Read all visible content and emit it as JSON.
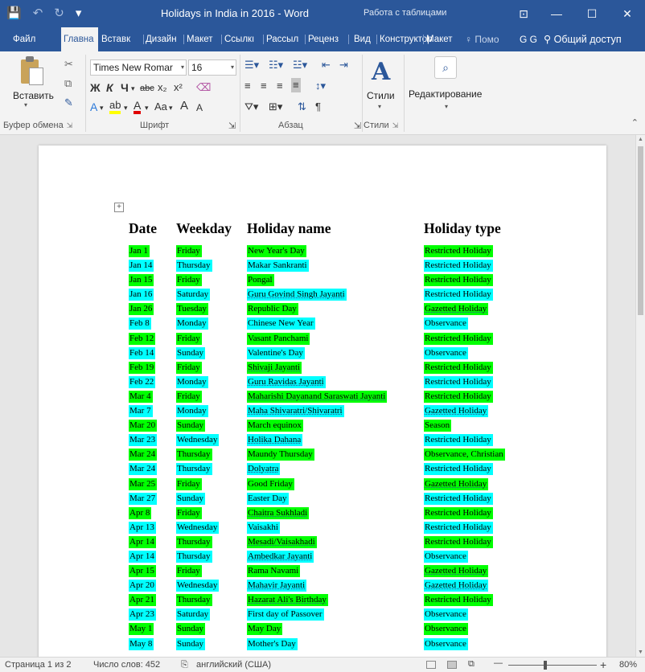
{
  "title_bar": {
    "doc_title": "Holidays in India in 2016 - Word",
    "context_title": "Работа с таблицами",
    "qat": {
      "save_icon": "💾",
      "undo_icon": "↶",
      "redo_icon": "↻",
      "customize_icon": "▾"
    },
    "buttons": {
      "ribbon_options": "⊡",
      "minimize": "—",
      "maximize": "☐",
      "close": "✕"
    }
  },
  "tabs": [
    {
      "label": "Файл"
    },
    {
      "label": "Главна"
    },
    {
      "label": "Вставк"
    },
    {
      "label": "Дизайн"
    },
    {
      "label": "Макет"
    },
    {
      "label": "Ссылкı"
    },
    {
      "label": "Рассыл"
    },
    {
      "label": "Реценз"
    },
    {
      "label": "Вид"
    },
    {
      "label": "Конструктор"
    },
    {
      "label": "Макет"
    }
  ],
  "tellme": "Помо",
  "user_initials": "G G",
  "share": "Общий доступ",
  "ribbon": {
    "paste_label": "Вставить",
    "font_name": "Times New Romar",
    "font_size": "16",
    "bold": "Ж",
    "italic": "К",
    "underline": "Ч",
    "strike": "abc",
    "subscript": "x₂",
    "superscript": "x²",
    "change_case": "Aa",
    "grow": "A",
    "shrink": "A",
    "styles_label": "Стили",
    "edit_label": "Редактирование",
    "groups": {
      "clipboard": "Буфер обмена",
      "font": "Шрифт",
      "paragraph": "Абзац",
      "styles": "Стили"
    }
  },
  "table": {
    "headers": {
      "date": "Date",
      "weekday": "Weekday",
      "name": "Holiday name",
      "type": "Holiday type"
    },
    "rows": [
      {
        "date": "Jan 1",
        "weekday": "Friday",
        "name": "New Year's Day",
        "type": "Restricted Holiday"
      },
      {
        "date": "Jan 14",
        "weekday": "Thursday",
        "name": "Makar Sankranti",
        "type": "Restricted Holiday"
      },
      {
        "date": "Jan 15",
        "weekday": "Friday",
        "name": "Pongal",
        "type": "Restricted Holiday"
      },
      {
        "date": "Jan 16",
        "weekday": "Saturday",
        "name": "Guru Govind Singh Jayanti",
        "type": "Restricted Holiday"
      },
      {
        "date": "Jan 26",
        "weekday": "Tuesday",
        "name": "Republic Day",
        "type": "Gazetted Holiday"
      },
      {
        "date": "Feb 8",
        "weekday": "Monday",
        "name": "Chinese New Year",
        "type": "Observance"
      },
      {
        "date": "Feb 12",
        "weekday": "Friday",
        "name": "Vasant Panchami",
        "type": "Restricted Holiday"
      },
      {
        "date": "Feb 14",
        "weekday": "Sunday",
        "name": "Valentine's Day",
        "type": "Observance"
      },
      {
        "date": "Feb 19",
        "weekday": "Friday",
        "name": "Shivaji Jayanti",
        "type": "Restricted Holiday"
      },
      {
        "date": "Feb 22",
        "weekday": "Monday",
        "name": "Guru Ravidas Jayanti",
        "type": "Restricted Holiday"
      },
      {
        "date": "Mar 4",
        "weekday": "Friday",
        "name": "Maharishi Dayanand Saraswati Jayanti",
        "type": "Restricted Holiday"
      },
      {
        "date": "Mar 7",
        "weekday": "Monday",
        "name": "Maha Shivaratri/Shivaratri",
        "type": "Gazetted Holiday"
      },
      {
        "date": "Mar 20",
        "weekday": "Sunday",
        "name": "March equinox",
        "type": "Season"
      },
      {
        "date": "Mar 23",
        "weekday": "Wednesday",
        "name": "Holika Dahana",
        "type": "Restricted Holiday"
      },
      {
        "date": "Mar 24",
        "weekday": "Thursday",
        "name": "Maundy Thursday",
        "type": "Observance, Christian"
      },
      {
        "date": "Mar 24",
        "weekday": "Thursday",
        "name": "Dolyatra",
        "type": "Restricted Holiday"
      },
      {
        "date": "Mar 25",
        "weekday": "Friday",
        "name": "Good Friday",
        "type": "Gazetted Holiday"
      },
      {
        "date": "Mar 27",
        "weekday": "Sunday",
        "name": "Easter Day",
        "type": "Restricted Holiday"
      },
      {
        "date": "Apr 8",
        "weekday": "Friday",
        "name": "Chaitra Sukhladi",
        "type": "Restricted Holiday"
      },
      {
        "date": "Apr 13",
        "weekday": "Wednesday",
        "name": "Vaisakhi",
        "type": "Restricted Holiday"
      },
      {
        "date": "Apr 14",
        "weekday": "Thursday",
        "name": "Mesadi/Vaisakhadi",
        "type": "Restricted Holiday"
      },
      {
        "date": "Apr 14",
        "weekday": "Thursday",
        "name": "Ambedkar Jayanti",
        "type": "Observance"
      },
      {
        "date": "Apr 15",
        "weekday": "Friday",
        "name": "Rama Navami",
        "type": "Gazetted Holiday"
      },
      {
        "date": "Apr 20",
        "weekday": "Wednesday",
        "name": "Mahavir Jayanti",
        "type": "Gazetted Holiday"
      },
      {
        "date": "Apr 21",
        "weekday": "Thursday",
        "name": "Hazarat Ali's Birthday",
        "type": "Restricted Holiday"
      },
      {
        "date": "Apr 23",
        "weekday": "Saturday",
        "name": "First day of Passover",
        "type": "Observance"
      },
      {
        "date": "May 1",
        "weekday": "Sunday",
        "name": "May Day",
        "type": "Observance"
      },
      {
        "date": "May 8",
        "weekday": "Sunday",
        "name": "Mother's Day",
        "type": "Observance"
      }
    ]
  },
  "status_bar": {
    "page": "Страница 1 из 2",
    "words": "Число слов: 452",
    "language": "английский (США)",
    "zoom": "80%",
    "zoom_out": "—",
    "zoom_in": "+"
  },
  "colors": {
    "word_blue": "#2b579a",
    "highlight_green": "#00ff00",
    "highlight_cyan": "#00ffff"
  }
}
